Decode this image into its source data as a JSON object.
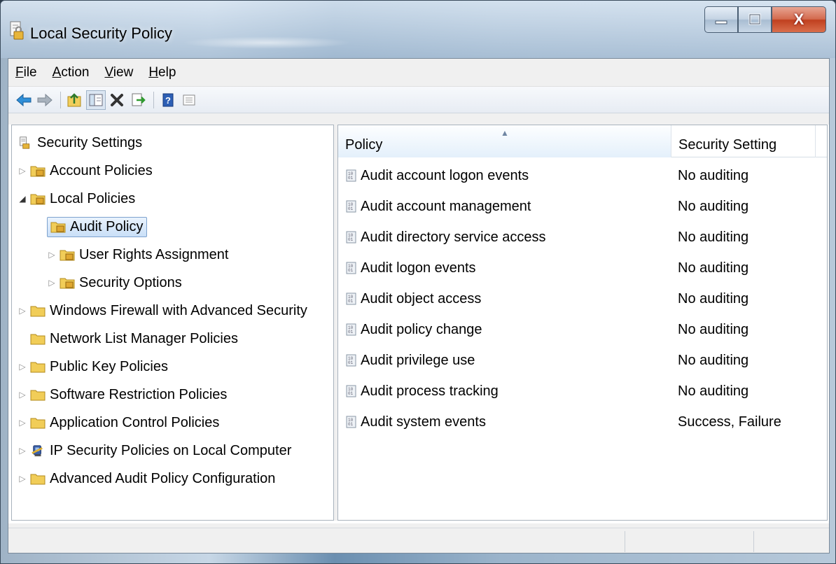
{
  "window": {
    "title": "Local Security Policy",
    "close_label": "X"
  },
  "menu": {
    "items": [
      {
        "label": "File",
        "accel": "F",
        "rest": "ile"
      },
      {
        "label": "Action",
        "accel": "A",
        "rest": "ction"
      },
      {
        "label": "View",
        "accel": "V",
        "rest": "iew"
      },
      {
        "label": "Help",
        "accel": "H",
        "rest": "elp"
      }
    ]
  },
  "toolbar": {
    "buttons": [
      "back-icon",
      "forward-icon",
      "up-folder-icon",
      "show-hide-tree-icon",
      "delete-icon",
      "export-list-icon",
      "help-icon",
      "properties-icon"
    ]
  },
  "tree": {
    "root": "Security Settings",
    "nodes": [
      {
        "label": "Account Policies"
      },
      {
        "label": "Local Policies"
      },
      {
        "label": "Audit Policy"
      },
      {
        "label": "User Rights Assignment"
      },
      {
        "label": "Security Options"
      },
      {
        "label": "Windows Firewall with Advanced Security"
      },
      {
        "label": "Network List Manager Policies"
      },
      {
        "label": "Public Key Policies"
      },
      {
        "label": "Software Restriction Policies"
      },
      {
        "label": "Application Control Policies"
      },
      {
        "label": "IP Security Policies on Local Computer"
      },
      {
        "label": "Advanced Audit Policy Configuration"
      }
    ]
  },
  "list": {
    "columns": {
      "policy": "Policy",
      "setting": "Security Setting"
    },
    "rows": [
      {
        "policy": "Audit account logon events",
        "setting": "No auditing"
      },
      {
        "policy": "Audit account management",
        "setting": "No auditing"
      },
      {
        "policy": "Audit directory service access",
        "setting": "No auditing"
      },
      {
        "policy": "Audit logon events",
        "setting": "No auditing"
      },
      {
        "policy": "Audit object access",
        "setting": "No auditing"
      },
      {
        "policy": "Audit policy change",
        "setting": "No auditing"
      },
      {
        "policy": "Audit privilege use",
        "setting": "No auditing"
      },
      {
        "policy": "Audit process tracking",
        "setting": "No auditing"
      },
      {
        "policy": "Audit system events",
        "setting": "Success, Failure"
      }
    ]
  },
  "colors": {
    "selection_border": "#7da2ce",
    "close_button": "#c0401f"
  }
}
